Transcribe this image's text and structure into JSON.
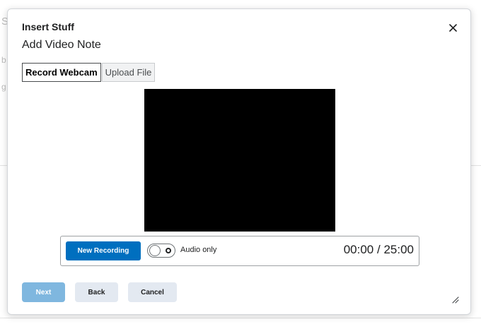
{
  "background_fragments": [
    "S",
    "b",
    "g"
  ],
  "dialog": {
    "title": "Insert Stuff",
    "heading": "Add Video Note",
    "close_icon": "close-icon"
  },
  "tabs": [
    {
      "label": "Record Webcam",
      "active": true
    },
    {
      "label": "Upload File",
      "active": false
    }
  ],
  "recorder": {
    "new_recording_label": "New Recording",
    "audio_only_label": "Audio only",
    "audio_only_enabled": false,
    "elapsed": "00:00",
    "separator": "/",
    "limit": "25:00"
  },
  "footer": {
    "next_label": "Next",
    "back_label": "Back",
    "cancel_label": "Cancel"
  },
  "colors": {
    "primary": "#006fbf",
    "primary_disabled": "#7fb7df",
    "secondary_bg": "#e3e9f1",
    "video_bg": "#000000"
  }
}
